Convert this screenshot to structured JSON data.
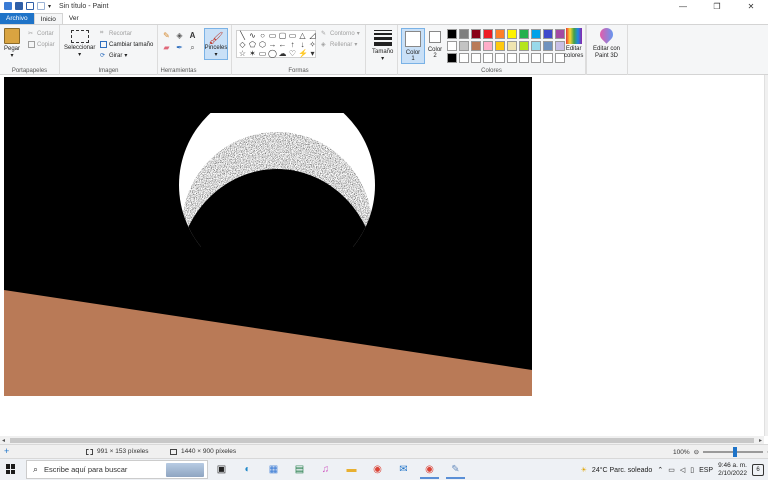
{
  "app": {
    "title": "Sin título - Paint",
    "window_controls": [
      "—",
      "❐",
      "✕"
    ]
  },
  "menu": {
    "tabs": [
      "Archivo",
      "Inicio",
      "Ver"
    ]
  },
  "ribbon": {
    "clipboard": {
      "label": "Portapapeles",
      "paste": "Pegar",
      "cut": "Cortar",
      "copy": "Copiar"
    },
    "image": {
      "label": "Imagen",
      "select": "Seleccionar",
      "crop": "Recortar",
      "resize": "Cambiar tamaño",
      "rotate": "Girar"
    },
    "tools": {
      "label": "Herramientas",
      "brushes": "Pinceles"
    },
    "shapes": {
      "label": "Formas",
      "outline": "Contorno",
      "fill": "Rellenar",
      "glyphs": [
        "╲",
        "∿",
        "○",
        "▭",
        "▢",
        "▭",
        "△",
        "◿",
        "◇",
        "⬠",
        "⬡",
        "→",
        "←",
        "↑",
        "↓",
        "✧",
        "☆",
        "✶",
        "▭",
        "◯",
        "☁",
        "♡",
        "⚡",
        "▾"
      ]
    },
    "size": {
      "label": "Tamaño"
    },
    "colors": {
      "label": "Colores",
      "color1": [
        "Color",
        "1"
      ],
      "color2": [
        "Color",
        "2"
      ],
      "edit_colors": [
        "Editar",
        "colores"
      ],
      "paint3d": [
        "Editar con",
        "Paint 3D"
      ],
      "palette": [
        "#000000",
        "#7f7f7f",
        "#880015",
        "#ed1c24",
        "#ff7f27",
        "#fff200",
        "#22b14c",
        "#00a2e8",
        "#3f48cc",
        "#a349a4",
        "#ffffff",
        "#c3c3c3",
        "#b97a57",
        "#ffaec9",
        "#ffc90e",
        "#efe4b0",
        "#b5e61d",
        "#99d9ea",
        "#7092be",
        "#c8bfe7",
        "#000000",
        "#ffffff",
        "#ffffff",
        "#ffffff",
        "#ffffff",
        "#ffffff",
        "#ffffff",
        "#ffffff",
        "#ffffff",
        "#ffffff"
      ]
    }
  },
  "canvas": {
    "background": "#000000",
    "ground_color": "#b97a57",
    "moon_color": "#ffffff"
  },
  "status": {
    "selection": "991 × 153 píxeles",
    "image_size": "1440 × 900 píxeles",
    "zoom": "100%"
  },
  "taskbar": {
    "search_placeholder": "Escribe aquí para buscar",
    "weather": "24°C  Parc. soleado",
    "language": "ESP",
    "time": "9:46 a. m.",
    "date": "2/10/2022",
    "notifications": "6"
  }
}
